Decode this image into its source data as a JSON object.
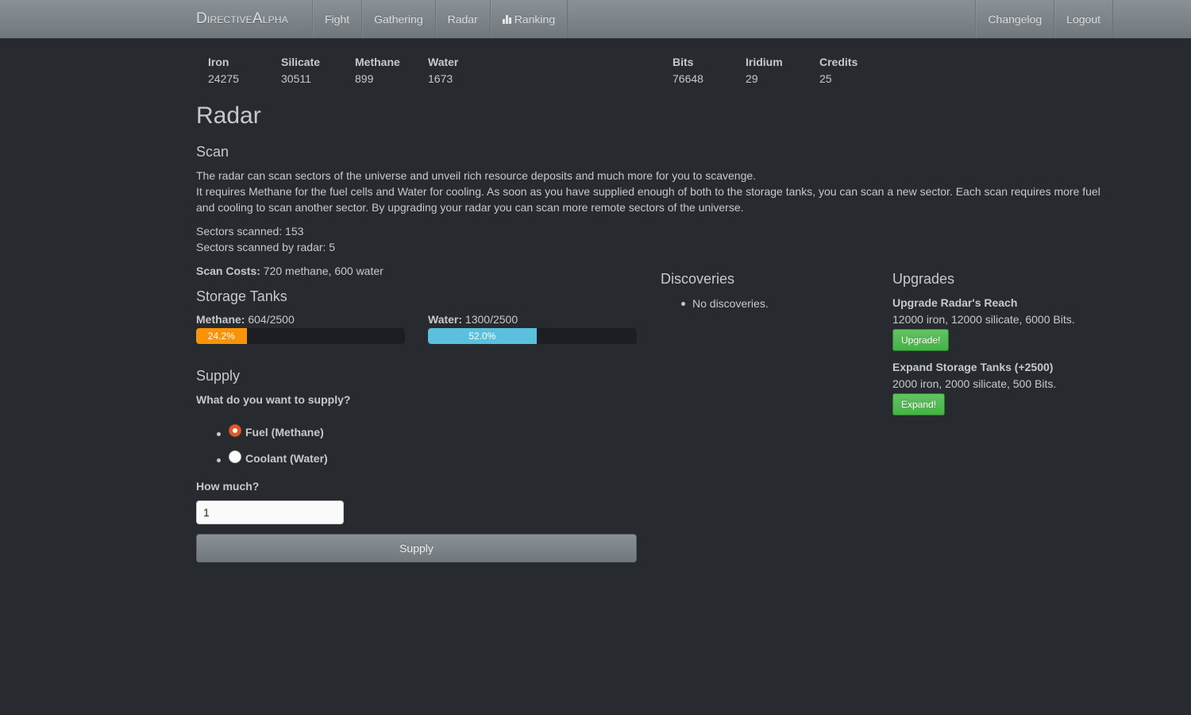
{
  "nav": {
    "brand_first_cap": "D",
    "brand_first_rest": "irective",
    "brand_second_cap": "A",
    "brand_second_rest": "lpha",
    "left_items": [
      "Fight",
      "Gathering",
      "Radar",
      "Ranking"
    ],
    "right_items": [
      "Changelog",
      "Logout"
    ],
    "ranking_icon": "bar-chart-icon"
  },
  "resources": [
    {
      "label": "Iron",
      "value": "24275"
    },
    {
      "label": "Silicate",
      "value": "30511"
    },
    {
      "label": "Methane",
      "value": "899"
    },
    {
      "label": "Water",
      "value": "1673"
    },
    {
      "label": "Bits",
      "value": "76648"
    },
    {
      "label": "Iridium",
      "value": "29"
    },
    {
      "label": "Credits",
      "value": "25"
    }
  ],
  "page": {
    "title": "Radar",
    "scan": {
      "heading": "Scan",
      "desc_line1": "The radar can scan sectors of the universe and unveil rich resource deposits and much more for you to scavenge.",
      "desc_line2": "It requires Methane for the fuel cells and Water for cooling. As soon as you have supplied enough of both to the storage tanks, you can scan a new sector. Each scan requires more fuel and cooling to scan another sector. By upgrading your radar you can scan more remote sectors of the universe.",
      "sectors_scanned": "Sectors scanned: 153",
      "sectors_by_radar": "Sectors scanned by radar: 5",
      "costs_label": "Scan Costs:",
      "costs_value": " 720 methane, 600 water"
    },
    "storage": {
      "heading": "Storage Tanks",
      "tanks": [
        {
          "label": "Methane:",
          "value": " 604/2500",
          "percent": 24.2,
          "percent_text": "24.2%",
          "color": "#f89406"
        },
        {
          "label": "Water:",
          "value": " 1300/2500",
          "percent": 52.0,
          "percent_text": "52.0%",
          "color": "#5bc0de"
        }
      ]
    },
    "supply": {
      "heading": "Supply",
      "question": "What do you want to supply?",
      "options": [
        {
          "label": "Fuel (Methane)",
          "checked": true
        },
        {
          "label": "Coolant (Water)",
          "checked": false
        }
      ],
      "amount_label": "How much?",
      "amount_value": "1",
      "submit_label": "Supply"
    },
    "discoveries": {
      "heading": "Discoveries",
      "items": [
        "No discoveries."
      ]
    },
    "upgrades": {
      "heading": "Upgrades",
      "items": [
        {
          "name": "Upgrade Radar's Reach",
          "cost": "12000 iron, 12000 silicate, 6000 Bits.",
          "button": "Upgrade!"
        },
        {
          "name": "Expand Storage Tanks (+2500)",
          "cost": "2000 iron, 2000 silicate, 500 Bits.",
          "button": "Expand!"
        }
      ]
    }
  }
}
